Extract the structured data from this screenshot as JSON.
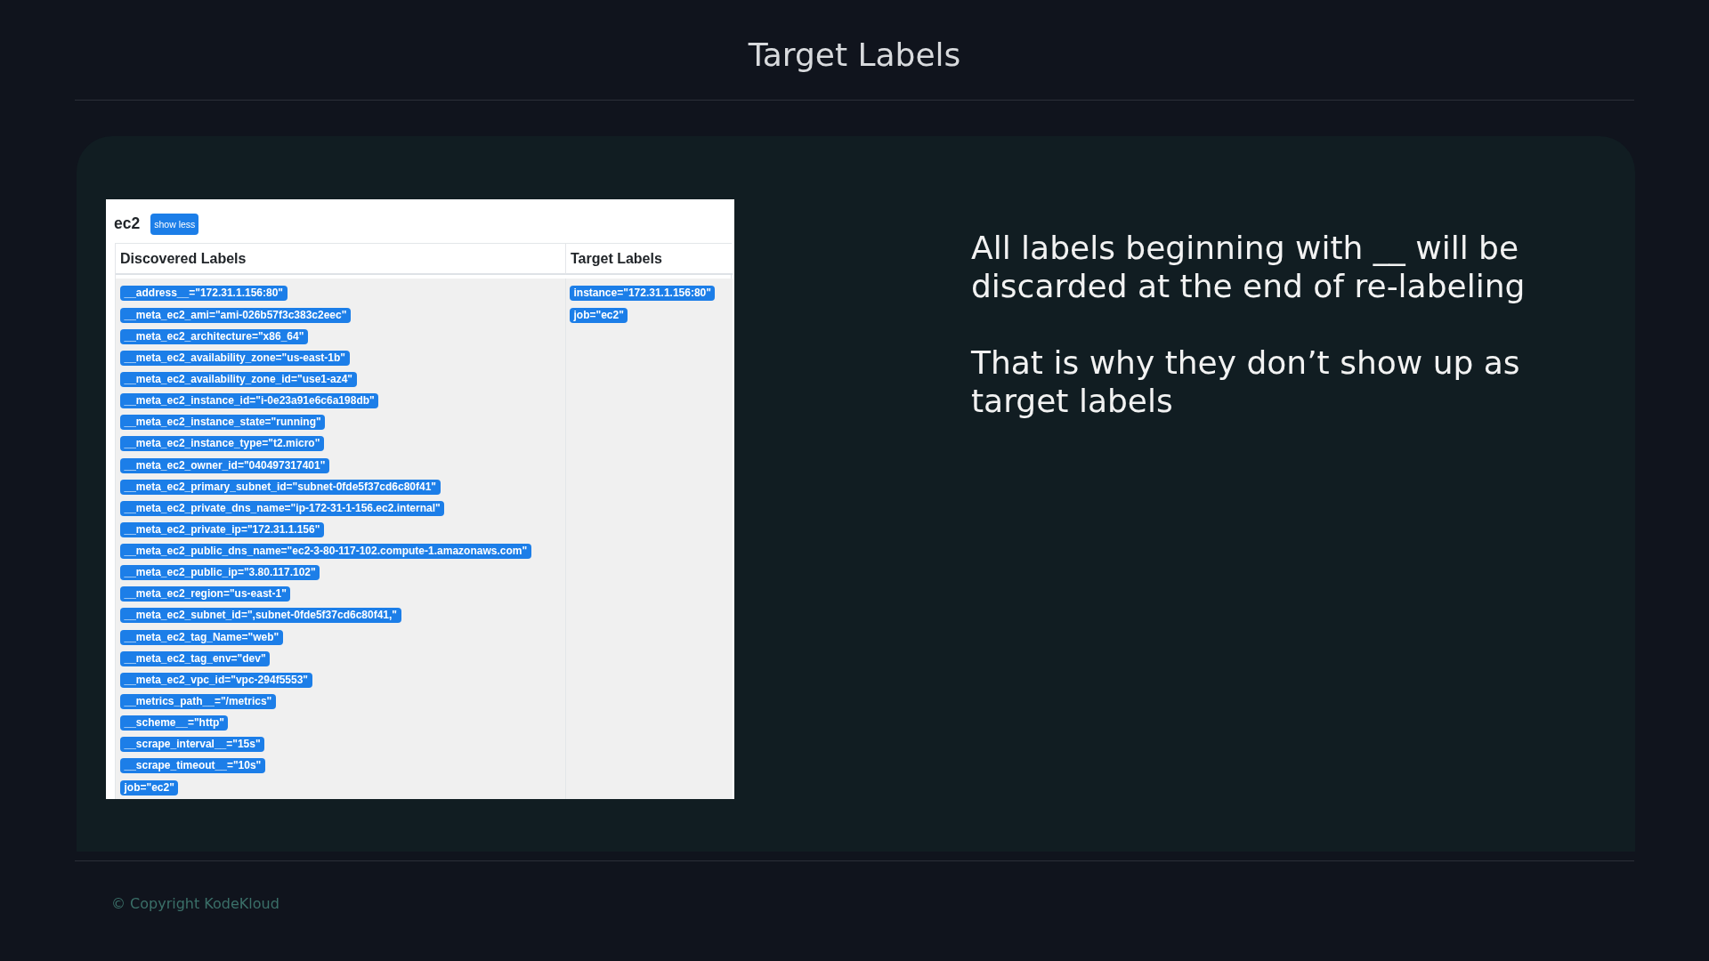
{
  "slide": {
    "title": "Target Labels"
  },
  "target_panel": {
    "job_name": "ec2",
    "toggle_button": "show less",
    "columns": [
      "Discovered Labels",
      "Target Labels"
    ],
    "discovered_labels": [
      "__address__=\"172.31.1.156:80\"",
      "__meta_ec2_ami=\"ami-026b57f3c383c2eec\"",
      "__meta_ec2_architecture=\"x86_64\"",
      "__meta_ec2_availability_zone=\"us-east-1b\"",
      "__meta_ec2_availability_zone_id=\"use1-az4\"",
      "__meta_ec2_instance_id=\"i-0e23a91e6c6a198db\"",
      "__meta_ec2_instance_state=\"running\"",
      "__meta_ec2_instance_type=\"t2.micro\"",
      "__meta_ec2_owner_id=\"040497317401\"",
      "__meta_ec2_primary_subnet_id=\"subnet-0fde5f37cd6c80f41\"",
      "__meta_ec2_private_dns_name=\"ip-172-31-1-156.ec2.internal\"",
      "__meta_ec2_private_ip=\"172.31.1.156\"",
      "__meta_ec2_public_dns_name=\"ec2-3-80-117-102.compute-1.amazonaws.com\"",
      "__meta_ec2_public_ip=\"3.80.117.102\"",
      "__meta_ec2_region=\"us-east-1\"",
      "__meta_ec2_subnet_id=\",subnet-0fde5f37cd6c80f41,\"",
      "__meta_ec2_tag_Name=\"web\"",
      "__meta_ec2_tag_env=\"dev\"",
      "__meta_ec2_vpc_id=\"vpc-294f5553\"",
      "__metrics_path__=\"/metrics\"",
      "__scheme__=\"http\"",
      "__scrape_interval__=\"15s\"",
      "__scrape_timeout__=\"10s\"",
      "job=\"ec2\""
    ],
    "target_labels": [
      "instance=\"172.31.1.156:80\"",
      "job=\"ec2\""
    ]
  },
  "notes": [
    "All labels beginning with __ will be discarded at the end of re-labeling",
    "That is why they don’t show up as target labels"
  ],
  "footer": {
    "copyright": "© Copyright KodeKloud"
  }
}
